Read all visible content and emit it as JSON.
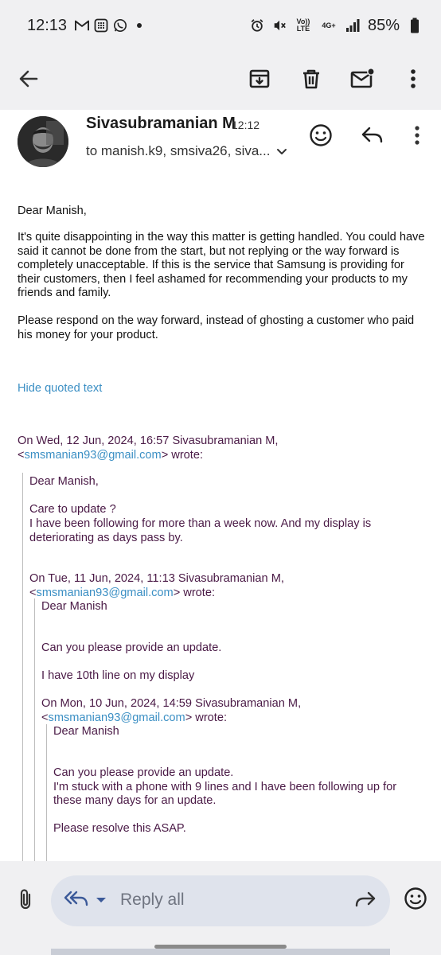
{
  "status_bar": {
    "time": "12:13",
    "battery": "85%",
    "volte_label": "Vo)) LTE",
    "network_label": "4G+"
  },
  "toolbar": {
    "back_icon": "arrow-left-icon",
    "archive_icon": "archive-icon",
    "delete_icon": "trash-icon",
    "mark_unread_icon": "mail-unread-icon",
    "more_icon": "more-vert-icon"
  },
  "message": {
    "sender": "Sivasubramanian M",
    "time": "12:12",
    "recipients": "to manish.k9, smsiva26, siva...",
    "greeting": "Dear Manish,",
    "paragraph1": "It's quite disappointing in the way this matter is getting handled. You could have said it cannot be done from the start, but not replying or the way forward is completely unacceptable.  If this is the service that Samsung is providing for their customers, then I feel ashamed for recommending your products to my friends and family.",
    "paragraph2": "Please respond on the way forward, instead of ghosting a customer who paid his money for your product.",
    "hide_quoted": "Hide quoted text"
  },
  "quotes": {
    "q1_header_line1": "On Wed, 12 Jun, 2024, 16:57 Sivasubramanian M,",
    "q1_email": "smsmanian93@gmail.com",
    "q1_wrote": "> wrote:",
    "q1_lt": "<",
    "q1_greeting": "Dear Manish,",
    "q1_line1": "Care to update ?",
    "q1_line2": "I have been following for more than a week now. And my display is",
    "q1_line3": "deteriorating as days pass by.",
    "q2_header_line1": "On Tue, 11 Jun, 2024, 11:13 Sivasubramanian M,",
    "q2_email": "smsmanian93@gmail.com",
    "q2_wrote": "> wrote:",
    "q2_lt": "<",
    "q2_greeting": "Dear Manish",
    "q2_line1": "Can you please provide an update.",
    "q2_line2": "I have 10th line on my display",
    "q3_header_line1": "On Mon, 10 Jun, 2024, 14:59 Sivasubramanian M,",
    "q3_email": "smsmanian93@gmail.com",
    "q3_wrote": "> wrote:",
    "q3_lt": "<",
    "q3_greeting": "Dear Manish",
    "q3_line1": "Can you please provide an update.",
    "q3_line2": "I'm stuck with a phone with 9 lines and I have been following up for",
    "q3_line3": "these many days for an update.",
    "q3_line4": "Please resolve this ASAP."
  },
  "reply_bar": {
    "placeholder": "Reply all",
    "attach_icon": "paperclip-icon",
    "reply_all_icon": "reply-all-icon",
    "forward_icon": "forward-icon",
    "emoji_icon": "emoji-icon"
  },
  "colors": {
    "quoted_text": "#4a1a46",
    "link": "#3b8fc4",
    "pill": "#dfe3ec",
    "chrome": "#f0f0f2"
  }
}
